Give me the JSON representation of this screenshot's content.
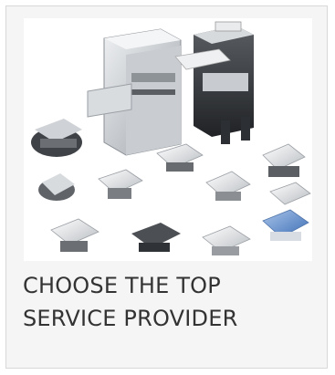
{
  "card": {
    "image_icon": "scanners-product-photo",
    "caption_line_1": "CHOOSE THE TOP",
    "caption_line_2": "SERVICE PROVIDER"
  },
  "colors": {
    "card_background": "#f5f5f5",
    "card_border": "#d8d8d8",
    "caption_text": "#333333"
  }
}
